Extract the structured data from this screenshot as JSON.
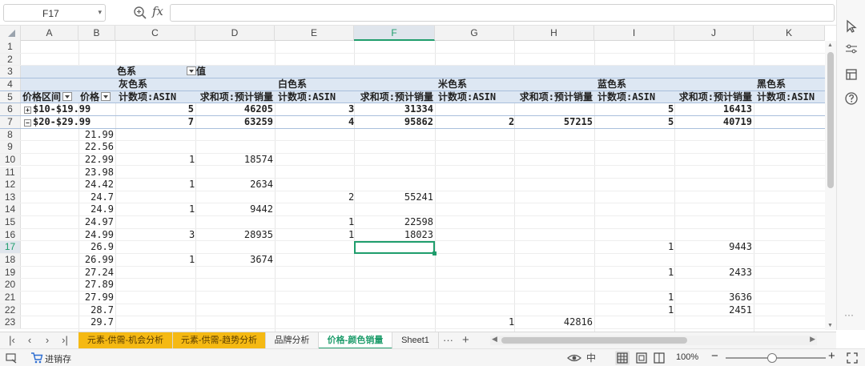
{
  "formula_bar": {
    "cell_ref": "F17",
    "fx_label": "fx",
    "formula_value": ""
  },
  "columns": [
    {
      "label": "A",
      "active": false
    },
    {
      "label": "B",
      "active": false
    },
    {
      "label": "C",
      "active": false
    },
    {
      "label": "D",
      "active": false
    },
    {
      "label": "E",
      "active": false
    },
    {
      "label": "F",
      "active": true
    },
    {
      "label": "G",
      "active": false
    },
    {
      "label": "H",
      "active": false
    },
    {
      "label": "I",
      "active": false
    },
    {
      "label": "J",
      "active": false
    },
    {
      "label": "K",
      "active": false
    }
  ],
  "pivot": {
    "row3": {
      "col_field": "色系",
      "values_label": "值"
    },
    "row4": {
      "grey": "灰色系",
      "white": "白色系",
      "beige": "米色系",
      "blue": "蓝色系",
      "black": "黑色系"
    },
    "row5": {
      "price_range_header": "价格区间",
      "price_header": "价格",
      "count_asin": "计数项:ASIN",
      "sum_sales": "求和项:预计销量"
    },
    "group_rows": [
      {
        "row_num": "6",
        "toggle": "+",
        "label": "$10-$19.99",
        "values": {
          "C": "5",
          "D": "46205",
          "E": "3",
          "F": "31334",
          "G": "",
          "H": "",
          "I": "5",
          "J": "16413"
        }
      },
      {
        "row_num": "7",
        "toggle": "−",
        "label": "$20-$29.99",
        "values": {
          "C": "7",
          "D": "63259",
          "E": "4",
          "F": "95862",
          "G": "2",
          "H": "57215",
          "I": "5",
          "J": "40719"
        }
      }
    ],
    "detail_rows": [
      {
        "row_num": "8",
        "price": "21.99",
        "C": "",
        "D": "",
        "E": "",
        "F": "",
        "G": "",
        "H": "",
        "I": "",
        "J": ""
      },
      {
        "row_num": "9",
        "price": "22.56",
        "C": "",
        "D": "",
        "E": "",
        "F": "",
        "G": "",
        "H": "",
        "I": "",
        "J": ""
      },
      {
        "row_num": "10",
        "price": "22.99",
        "C": "1",
        "D": "18574",
        "E": "",
        "F": "",
        "G": "",
        "H": "",
        "I": "",
        "J": ""
      },
      {
        "row_num": "11",
        "price": "23.98",
        "C": "",
        "D": "",
        "E": "",
        "F": "",
        "G": "",
        "H": "",
        "I": "",
        "J": ""
      },
      {
        "row_num": "12",
        "price": "24.42",
        "C": "1",
        "D": "2634",
        "E": "",
        "F": "",
        "G": "",
        "H": "",
        "I": "",
        "J": ""
      },
      {
        "row_num": "13",
        "price": "24.7",
        "C": "",
        "D": "",
        "E": "2",
        "F": "55241",
        "G": "",
        "H": "",
        "I": "",
        "J": ""
      },
      {
        "row_num": "14",
        "price": "24.9",
        "C": "1",
        "D": "9442",
        "E": "",
        "F": "",
        "G": "",
        "H": "",
        "I": "",
        "J": ""
      },
      {
        "row_num": "15",
        "price": "24.97",
        "C": "",
        "D": "",
        "E": "1",
        "F": "22598",
        "G": "",
        "H": "",
        "I": "",
        "J": ""
      },
      {
        "row_num": "16",
        "price": "24.99",
        "C": "3",
        "D": "28935",
        "E": "1",
        "F": "18023",
        "G": "",
        "H": "",
        "I": "",
        "J": ""
      },
      {
        "row_num": "17",
        "price": "26.9",
        "C": "",
        "D": "",
        "E": "",
        "F": "",
        "G": "",
        "H": "",
        "I": "1",
        "J": "9443"
      },
      {
        "row_num": "18",
        "price": "26.99",
        "C": "1",
        "D": "3674",
        "E": "",
        "F": "",
        "G": "",
        "H": "",
        "I": "",
        "J": ""
      },
      {
        "row_num": "19",
        "price": "27.24",
        "C": "",
        "D": "",
        "E": "",
        "F": "",
        "G": "",
        "H": "",
        "I": "1",
        "J": "2433"
      },
      {
        "row_num": "20",
        "price": "27.89",
        "C": "",
        "D": "",
        "E": "",
        "F": "",
        "G": "",
        "H": "",
        "I": "",
        "J": ""
      },
      {
        "row_num": "21",
        "price": "27.99",
        "C": "",
        "D": "",
        "E": "",
        "F": "",
        "G": "",
        "H": "",
        "I": "1",
        "J": "3636"
      },
      {
        "row_num": "22",
        "price": "28.7",
        "C": "",
        "D": "",
        "E": "",
        "F": "",
        "G": "",
        "H": "",
        "I": "1",
        "J": "2451"
      },
      {
        "row_num": "23",
        "price": "29.7",
        "C": "",
        "D": "",
        "E": "",
        "F": "",
        "G": "1",
        "H": "42816",
        "I": "",
        "J": ""
      }
    ]
  },
  "sheet_tabs": [
    {
      "label": "元素-供需-机会分析",
      "style": "orange"
    },
    {
      "label": "元素-供需-趋势分析",
      "style": "orange"
    },
    {
      "label": "品牌分析",
      "style": "normal"
    },
    {
      "label": "价格-颜色销量",
      "style": "active"
    },
    {
      "label": "Sheet1",
      "style": "normal"
    }
  ],
  "tab_more": "···",
  "tab_add": "+",
  "status": {
    "macro_label": "进销存",
    "input_mode": "中",
    "zoom_label": "100%",
    "zoom_level_percent": 100
  },
  "colors": {
    "accent": "#1f9d6c",
    "tab_orange": "#f5b913",
    "pivot_band": "#dde7f3"
  }
}
